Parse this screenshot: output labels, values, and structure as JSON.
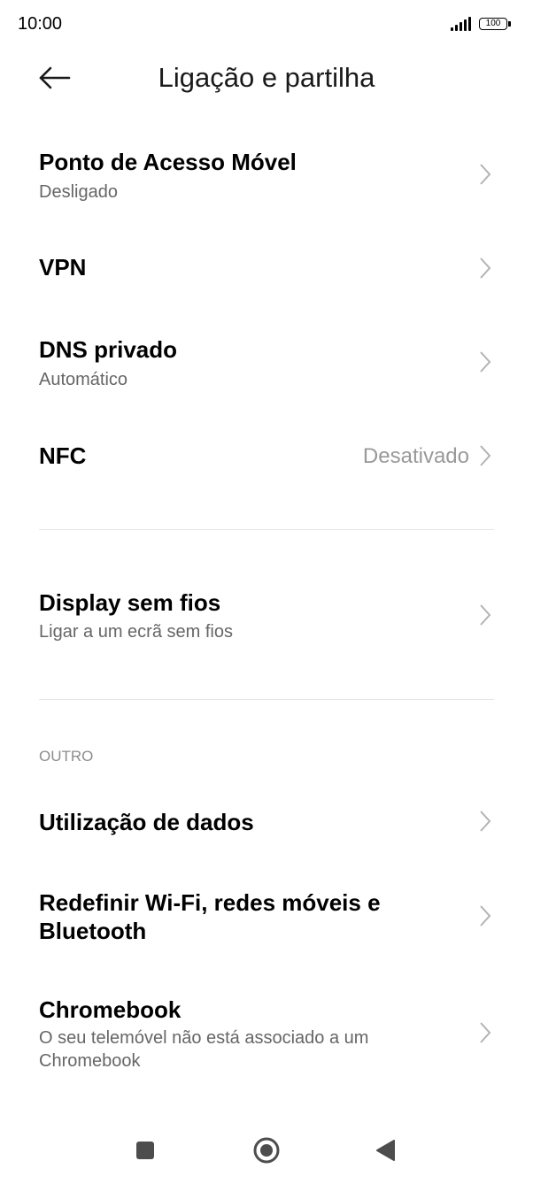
{
  "status_bar": {
    "time": "10:00",
    "battery": "100"
  },
  "header": {
    "title": "Ligação e partilha",
    "back_icon": "arrow-left-icon"
  },
  "items": {
    "hotspot": {
      "title": "Ponto de Acesso Móvel",
      "subtitle": "Desligado"
    },
    "vpn": {
      "title": "VPN"
    },
    "private_dns": {
      "title": "DNS privado",
      "subtitle": "Automático"
    },
    "nfc": {
      "title": "NFC",
      "value": "Desativado"
    },
    "wireless_display": {
      "title": "Display sem fios",
      "subtitle": "Ligar a um ecrã sem fios"
    }
  },
  "other_section": {
    "header": "OUTRO",
    "data_usage": {
      "title": "Utilização de dados"
    },
    "reset": {
      "title": "Redefinir Wi-Fi, redes móveis e Bluetooth"
    },
    "chromebook": {
      "title": "Chromebook",
      "subtitle": "O seu telemóvel não está associado a um Chromebook"
    }
  },
  "nav_bar": {
    "recents_icon": "square-icon",
    "home_icon": "circle-icon",
    "back_icon": "triangle-back-icon"
  },
  "colors": {
    "background": "#ffffff",
    "title_text": "#000000",
    "subtitle_text": "#666666",
    "value_text": "#999999",
    "chevron": "#b3b3b3",
    "divider": "#e6e6e6",
    "nav_icons": "#4d4d4d"
  }
}
